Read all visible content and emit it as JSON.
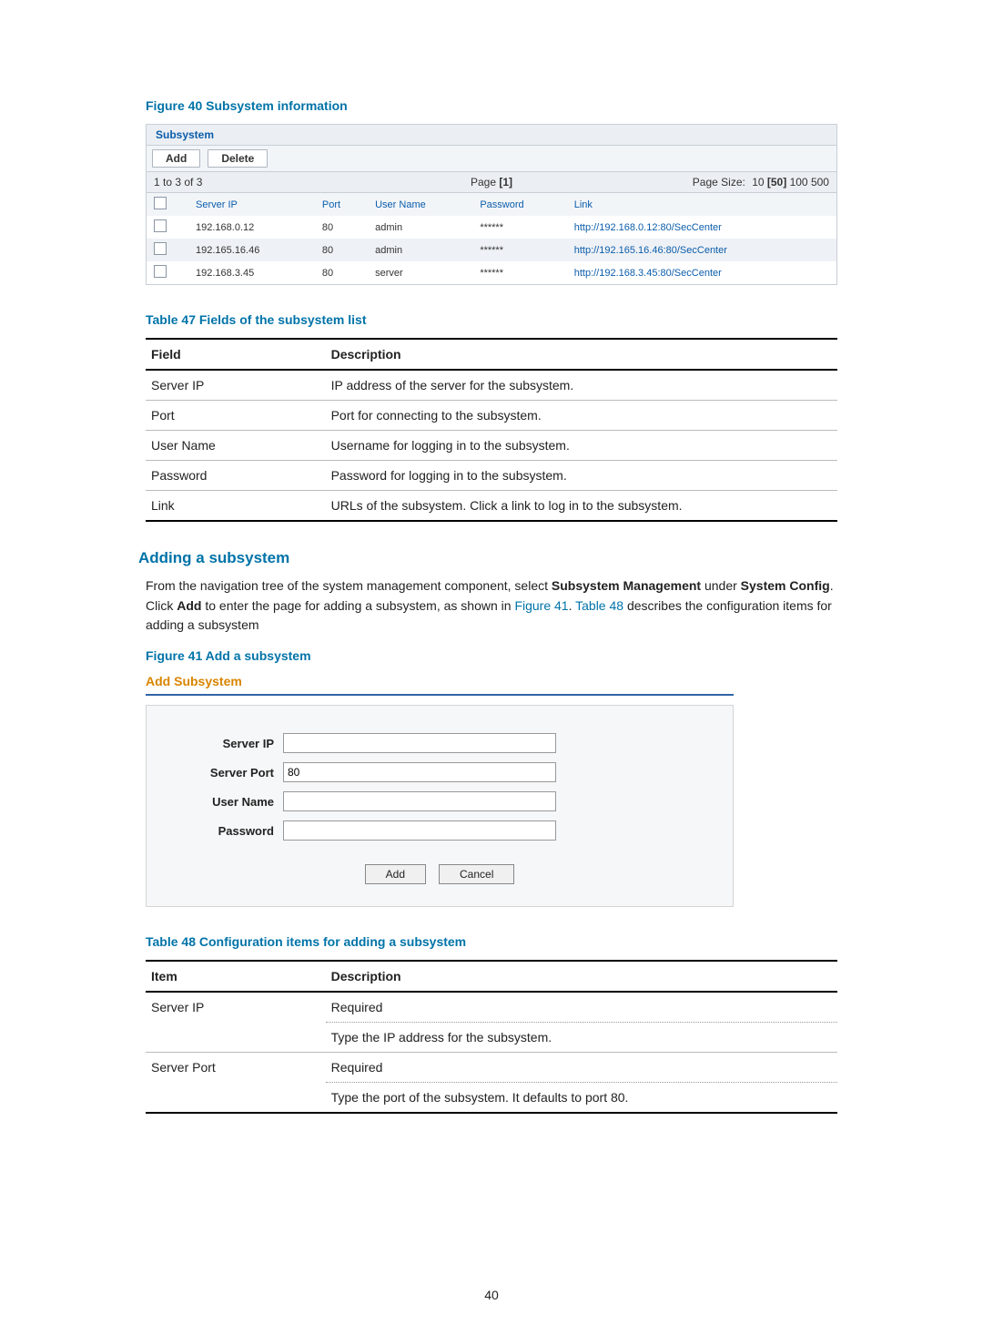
{
  "figure40": {
    "caption": "Figure 40 Subsystem information",
    "panel_title": "Subsystem",
    "toolbar": {
      "add": "Add",
      "delete": "Delete"
    },
    "pager": {
      "range": "1 to 3 of 3",
      "page_label": "Page",
      "page_current": "[1]",
      "page_size_label": "Page Size:",
      "sizes": {
        "s10": "10",
        "s50": "[50]",
        "s100": "100",
        "s500": "500"
      }
    },
    "columns": {
      "server_ip": "Server IP",
      "port": "Port",
      "user_name": "User Name",
      "password": "Password",
      "link": "Link"
    },
    "rows": [
      {
        "ip": "192.168.0.12",
        "port": "80",
        "user": "admin",
        "pw": "******",
        "link": "http://192.168.0.12:80/SecCenter"
      },
      {
        "ip": "192.165.16.46",
        "port": "80",
        "user": "admin",
        "pw": "******",
        "link": "http://192.165.16.46:80/SecCenter"
      },
      {
        "ip": "192.168.3.45",
        "port": "80",
        "user": "server",
        "pw": "******",
        "link": "http://192.168.3.45:80/SecCenter"
      }
    ]
  },
  "table47": {
    "caption": "Table 47 Fields of the subsystem list",
    "head": {
      "field": "Field",
      "desc": "Description"
    },
    "rows": [
      {
        "f": "Server IP",
        "d": "IP address of the server for the subsystem."
      },
      {
        "f": "Port",
        "d": "Port for connecting to the subsystem."
      },
      {
        "f": "User Name",
        "d": "Username for logging in to the subsystem."
      },
      {
        "f": "Password",
        "d": "Password for logging in to the subsystem."
      },
      {
        "f": "Link",
        "d": "URLs of the subsystem. Click a link to log in to the subsystem."
      }
    ]
  },
  "adding": {
    "heading": "Adding a subsystem",
    "para_1a": "From the navigation tree of the system management component, select ",
    "para_1b": "Subsystem Management",
    "para_1c": " under ",
    "para_1d": "System Config",
    "para_1e": ". Click ",
    "para_1f": "Add",
    "para_1g": " to enter the page for adding a subsystem, as shown in ",
    "ref_fig": "Figure 41",
    "para_1h": ". ",
    "ref_tab": "Table 48",
    "para_1i": " describes the configuration items for adding a subsystem"
  },
  "figure41": {
    "caption": "Figure 41 Add a subsystem",
    "form_title": "Add Subsystem",
    "labels": {
      "server_ip": "Server IP",
      "server_port": "Server Port",
      "user_name": "User Name",
      "password": "Password"
    },
    "values": {
      "server_ip": "",
      "server_port": "80",
      "user_name": "",
      "password": ""
    },
    "buttons": {
      "add": "Add",
      "cancel": "Cancel"
    }
  },
  "table48": {
    "caption": "Table 48 Configuration items for adding a subsystem",
    "head": {
      "item": "Item",
      "desc": "Description"
    },
    "rows": [
      {
        "item": "Server IP",
        "d1": "Required",
        "d2": "Type the IP address for the subsystem."
      },
      {
        "item": "Server Port",
        "d1": "Required",
        "d2": "Type the port of the subsystem. It defaults to port 80."
      }
    ]
  },
  "page_number": "40"
}
